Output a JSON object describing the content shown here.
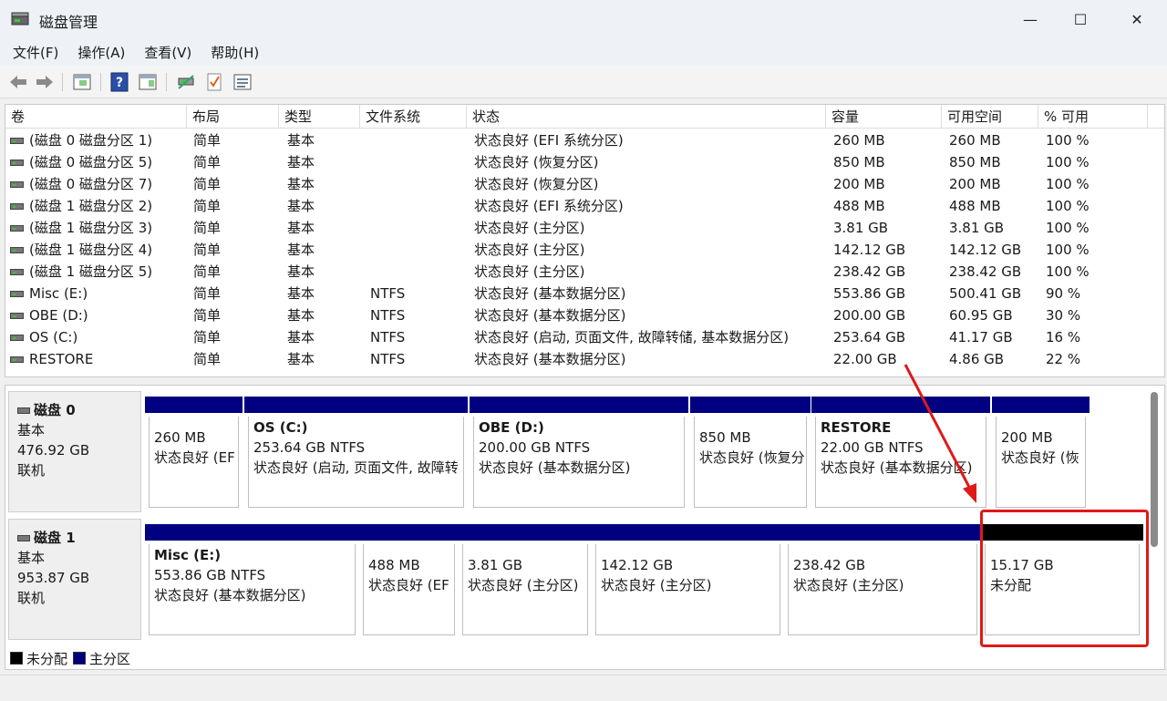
{
  "window": {
    "title": "磁盘管理",
    "minimize": "—",
    "maximize": "☐",
    "close": "✕"
  },
  "menu": [
    "文件(F)",
    "操作(A)",
    "查看(V)",
    "帮助(H)"
  ],
  "toolbar": [
    "back-icon",
    "forward-icon",
    "disk-list-icon",
    "help-icon",
    "properties-icon",
    "connect-icon",
    "check-icon",
    "detail-icon"
  ],
  "volume_table": {
    "headers": [
      "卷",
      "布局",
      "类型",
      "文件系统",
      "状态",
      "容量",
      "可用空间",
      "% 可用"
    ],
    "rows": [
      [
        "(磁盘 0 磁盘分区 1)",
        "简单",
        "基本",
        "",
        "状态良好 (EFI 系统分区)",
        "260 MB",
        "260 MB",
        "100 %"
      ],
      [
        "(磁盘 0 磁盘分区 5)",
        "简单",
        "基本",
        "",
        "状态良好 (恢复分区)",
        "850 MB",
        "850 MB",
        "100 %"
      ],
      [
        "(磁盘 0 磁盘分区 7)",
        "简单",
        "基本",
        "",
        "状态良好 (恢复分区)",
        "200 MB",
        "200 MB",
        "100 %"
      ],
      [
        "(磁盘 1 磁盘分区 2)",
        "简单",
        "基本",
        "",
        "状态良好 (EFI 系统分区)",
        "488 MB",
        "488 MB",
        "100 %"
      ],
      [
        "(磁盘 1 磁盘分区 3)",
        "简单",
        "基本",
        "",
        "状态良好 (主分区)",
        "3.81 GB",
        "3.81 GB",
        "100 %"
      ],
      [
        "(磁盘 1 磁盘分区 4)",
        "简单",
        "基本",
        "",
        "状态良好 (主分区)",
        "142.12 GB",
        "142.12 GB",
        "100 %"
      ],
      [
        "(磁盘 1 磁盘分区 5)",
        "简单",
        "基本",
        "",
        "状态良好 (主分区)",
        "238.42 GB",
        "238.42 GB",
        "100 %"
      ],
      [
        "Misc (E:)",
        "简单",
        "基本",
        "NTFS",
        "状态良好 (基本数据分区)",
        "553.86 GB",
        "500.41 GB",
        "90 %"
      ],
      [
        "OBE (D:)",
        "简单",
        "基本",
        "NTFS",
        "状态良好 (基本数据分区)",
        "200.00 GB",
        "60.95 GB",
        "30 %"
      ],
      [
        "OS (C:)",
        "简单",
        "基本",
        "NTFS",
        "状态良好 (启动, 页面文件, 故障转储, 基本数据分区)",
        "253.64 GB",
        "41.17 GB",
        "16 %"
      ],
      [
        "RESTORE",
        "简单",
        "基本",
        "NTFS",
        "状态良好 (基本数据分区)",
        "22.00 GB",
        "4.86 GB",
        "22 %"
      ]
    ]
  },
  "disks": [
    {
      "name": "磁盘 0",
      "type": "基本",
      "size": "476.92 GB",
      "state": "联机",
      "partitions": [
        {
          "title": "",
          "line1": "260 MB",
          "line2": "状态良好 (EF",
          "kind": "primary"
        },
        {
          "title": "OS  (C:)",
          "line1": "253.64 GB NTFS",
          "line2": "状态良好 (启动, 页面文件, 故障转",
          "kind": "primary"
        },
        {
          "title": "OBE  (D:)",
          "line1": "200.00 GB NTFS",
          "line2": "状态良好 (基本数据分区)",
          "kind": "primary"
        },
        {
          "title": "",
          "line1": "850 MB",
          "line2": "状态良好 (恢复分",
          "kind": "primary"
        },
        {
          "title": "RESTORE",
          "line1": "22.00 GB NTFS",
          "line2": "状态良好 (基本数据分区)",
          "kind": "primary"
        },
        {
          "title": "",
          "line1": "200 MB",
          "line2": "状态良好 (恢",
          "kind": "primary"
        }
      ]
    },
    {
      "name": "磁盘 1",
      "type": "基本",
      "size": "953.87 GB",
      "state": "联机",
      "partitions": [
        {
          "title": "Misc  (E:)",
          "line1": "553.86 GB NTFS",
          "line2": "状态良好 (基本数据分区)",
          "kind": "primary"
        },
        {
          "title": "",
          "line1": "488 MB",
          "line2": "状态良好 (EF",
          "kind": "primary"
        },
        {
          "title": "",
          "line1": "3.81 GB",
          "line2": "状态良好 (主分区)",
          "kind": "primary"
        },
        {
          "title": "",
          "line1": "142.12 GB",
          "line2": "状态良好 (主分区)",
          "kind": "primary"
        },
        {
          "title": "",
          "line1": "238.42 GB",
          "line2": "状态良好 (主分区)",
          "kind": "primary"
        },
        {
          "title": "",
          "line1": "15.17 GB",
          "line2": "未分配",
          "kind": "unallocated"
        }
      ]
    }
  ],
  "legend": [
    {
      "label": "未分配",
      "color": "#000000"
    },
    {
      "label": "主分区",
      "color": "#00007f"
    }
  ],
  "colors": {
    "primary": "#000080",
    "unallocated": "#000000",
    "annotation": "#e01919"
  }
}
